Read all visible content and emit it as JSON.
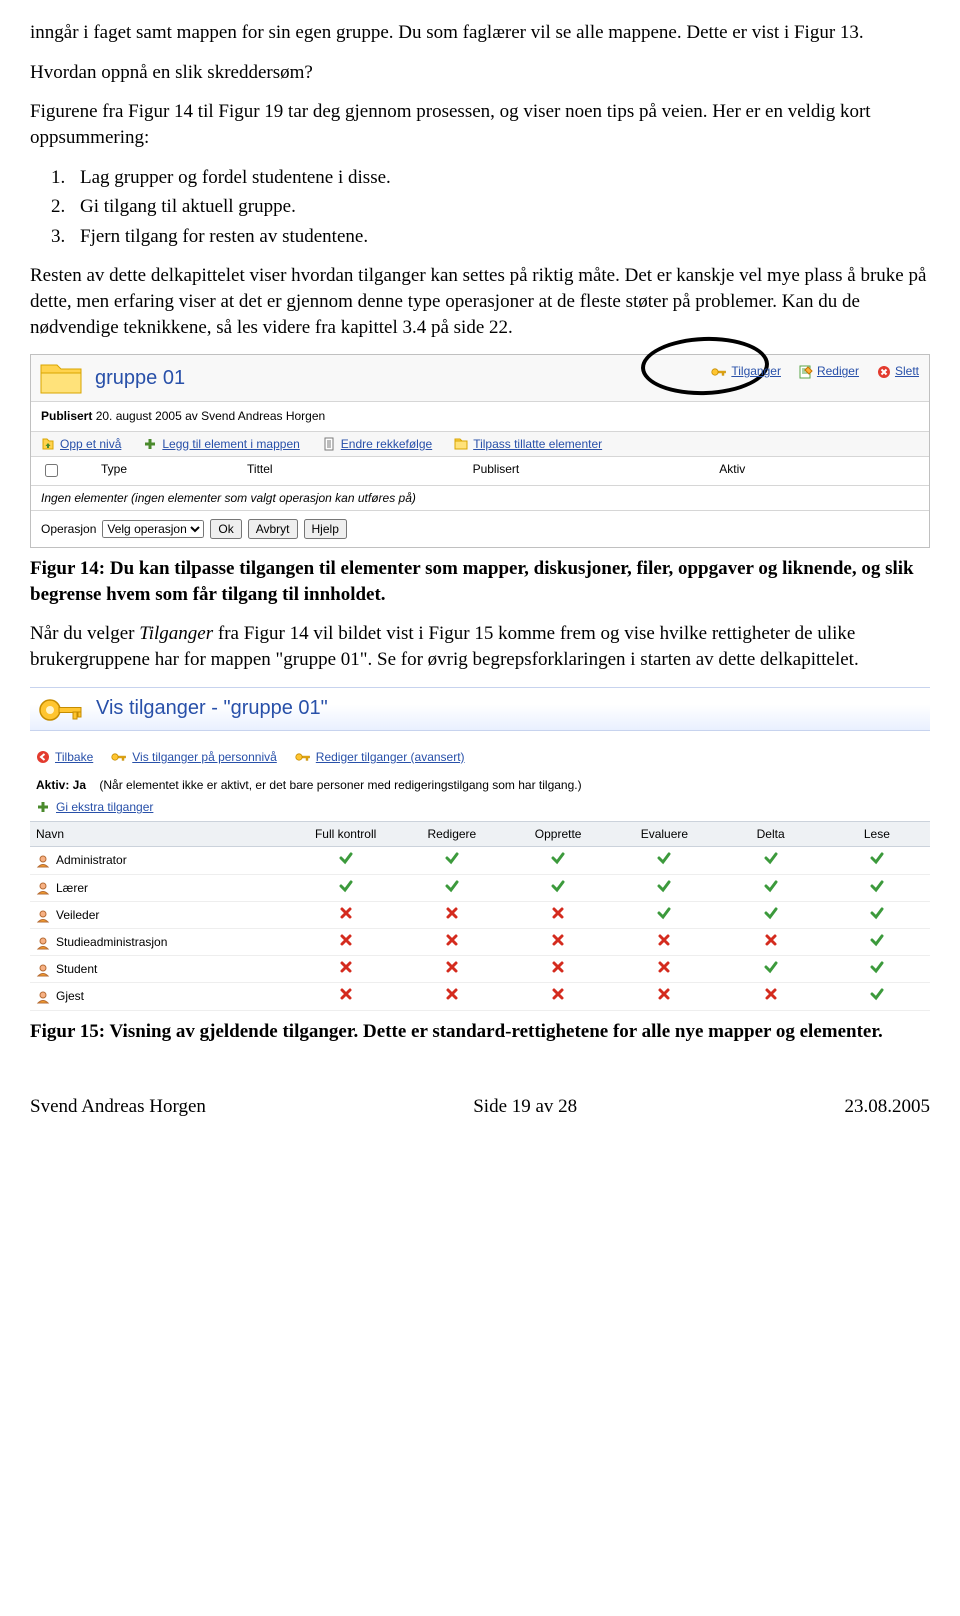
{
  "paragraphs": {
    "p1": "inngår i faget samt mappen for sin egen gruppe. Du som faglærer vil se alle mappene. Dette er vist i Figur 13.",
    "p2": "Hvordan oppnå en slik skreddersøm?",
    "p3": "Figurene fra Figur 14 til Figur 19 tar deg gjennom prosessen, og viser noen tips på veien. Her er en veldig kort oppsummering:",
    "ol": [
      "Lag grupper og fordel studentene i disse.",
      "Gi tilgang til aktuell gruppe.",
      "Fjern tilgang for resten av studentene."
    ],
    "p4": "Resten av dette delkapittelet viser hvordan tilganger kan settes på riktig måte. Det er kanskje vel mye plass å bruke på dette, men erfaring viser at det er gjennom denne type operasjoner at de fleste støter på problemer. Kan du de nødvendige teknikkene, så les videre fra kapittel 3.4 på side 22.",
    "fig14": "Figur 14: Du kan tilpasse tilgangen til elementer som mapper, diskusjoner, filer, oppgaver og liknende, og slik begrense hvem som får tilgang til innholdet.",
    "p5a": "Når du velger ",
    "p5i": "Tilganger",
    "p5b": " fra Figur 14 vil bildet vist i Figur 15 komme frem og vise hvilke rettigheter de ulike brukergruppene har for mappen \"gruppe 01\". Se for øvrig begrepsforklaringen i starten av dette delkapittelet.",
    "fig15": "Figur 15: Visning av gjeldende tilganger. Dette er standard-rettighetene for alle nye mapper og elementer."
  },
  "shot1": {
    "title": "gruppe 01",
    "links": {
      "tilganger": "Tilganger",
      "rediger": "Rediger",
      "slett": "Slett"
    },
    "published_label": "Publisert",
    "published_value": " 20. august 2005 av Svend Andreas Horgen",
    "toolbar": {
      "opp": "Opp et nivå",
      "legg": "Legg til element i mappen",
      "endre": "Endre rekkefølge",
      "tilpass": "Tilpass tillatte elementer"
    },
    "cols": {
      "type": "Type",
      "tittel": "Tittel",
      "publisert": "Publisert",
      "aktiv": "Aktiv"
    },
    "empty": "Ingen elementer (ingen elementer som valgt operasjon kan utføres på)",
    "operation_label": "Operasjon",
    "select": "Velg operasjon",
    "ok": "Ok",
    "avbryt": "Avbryt",
    "hjelp": "Hjelp"
  },
  "shot2": {
    "title": "Vis tilganger - \"gruppe 01\"",
    "links": {
      "tilbake": "Tilbake",
      "person": "Vis tilganger på personnivå",
      "avansert": "Rediger tilganger (avansert)"
    },
    "aktiv_label": "Aktiv: Ja",
    "aktiv_note": "(Når elementet ikke er aktivt, er det bare personer med redigeringstilgang som har tilgang.)",
    "extra": "Gi ekstra tilganger",
    "headers": [
      "Navn",
      "Full kontroll",
      "Redigere",
      "Opprette",
      "Evaluere",
      "Delta",
      "Lese"
    ],
    "rows": [
      {
        "name": "Administrator",
        "vals": [
          true,
          true,
          true,
          true,
          true,
          true
        ]
      },
      {
        "name": "Lærer",
        "vals": [
          true,
          true,
          true,
          true,
          true,
          true
        ]
      },
      {
        "name": "Veileder",
        "vals": [
          false,
          false,
          false,
          true,
          true,
          true
        ]
      },
      {
        "name": "Studieadministrasjon",
        "vals": [
          false,
          false,
          false,
          false,
          false,
          true
        ]
      },
      {
        "name": "Student",
        "vals": [
          false,
          false,
          false,
          false,
          true,
          true
        ]
      },
      {
        "name": "Gjest",
        "vals": [
          false,
          false,
          false,
          false,
          false,
          true
        ]
      }
    ]
  },
  "footer": {
    "left": "Svend Andreas Horgen",
    "center": "Side 19 av 28",
    "right": "23.08.2005"
  }
}
